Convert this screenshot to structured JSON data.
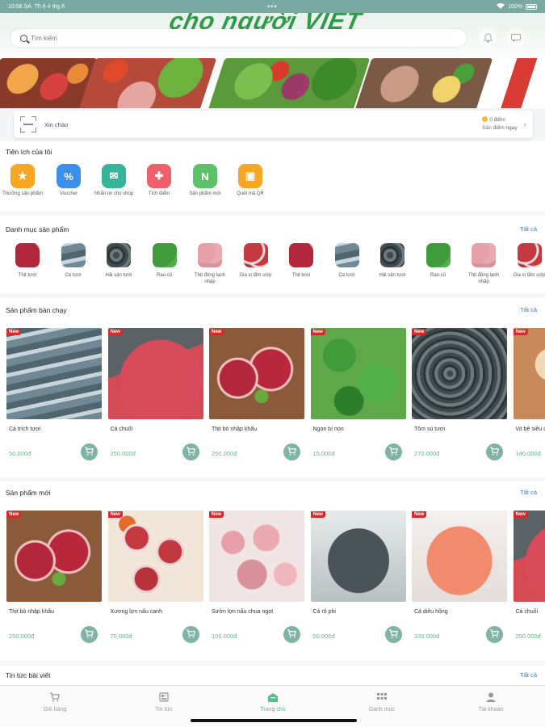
{
  "status_bar": {
    "time": "10:58 SA",
    "date": "Th 6 4 thg 8",
    "dots": "•••",
    "battery": "100%"
  },
  "banner": {
    "slogan": "cho người VIỆT"
  },
  "search": {
    "placeholder": "Tìm kiếm"
  },
  "greeting": {
    "text": "Xin chào",
    "points": "0 điểm",
    "points_link": "Săn điểm ngay"
  },
  "utilities": {
    "title": "Tiện ích của tôi",
    "items": [
      {
        "label": "Thưởng sản phẩm",
        "color": "#f5a623",
        "icon": "gift-icon"
      },
      {
        "label": "Voucher",
        "color": "#3d8fe8",
        "icon": "voucher-icon"
      },
      {
        "label": "Nhắn tin cho shop",
        "color": "#36b39a",
        "icon": "chat-icon"
      },
      {
        "label": "Tích điểm",
        "color": "#f0606a",
        "icon": "points-icon"
      },
      {
        "label": "Sản phẩm mới",
        "color": "#5cc26a",
        "icon": "new-product-icon"
      },
      {
        "label": "Quét mã QR",
        "color": "#f5a623",
        "icon": "qr-scan-icon"
      }
    ]
  },
  "categories": {
    "title": "Danh mục sản phẩm",
    "see_all": "Tất cả",
    "items": [
      {
        "label": "Thịt tươi",
        "style": "beef"
      },
      {
        "label": "Cá tươi",
        "style": "fish"
      },
      {
        "label": "Hải sản tươi",
        "style": "shrimp"
      },
      {
        "label": "Rau củ",
        "style": "greens"
      },
      {
        "label": "Thịt đông lạnh nhập",
        "style": "pork"
      },
      {
        "label": "Gia vị tẩm ướp",
        "style": "ribs"
      },
      {
        "label": "Thịt tươi",
        "style": "beef"
      },
      {
        "label": "Cá tươi",
        "style": "fish"
      },
      {
        "label": "Hải sản tươi",
        "style": "shrimp"
      },
      {
        "label": "Rau củ",
        "style": "greens"
      },
      {
        "label": "Thịt đông lạnh nhập",
        "style": "pork"
      },
      {
        "label": "Gia vị tẩm ướp",
        "style": "ribs"
      }
    ]
  },
  "best_sellers": {
    "title": "Sản phẩm bán chạy",
    "see_all": "Tất cả",
    "badge": "New",
    "items": [
      {
        "name": "Cá trích tươi",
        "price": "50.000đ",
        "style": "fish"
      },
      {
        "name": "Cá chuối",
        "price": "250.000đ",
        "style": "catfish"
      },
      {
        "name": "Thịt bò nhập khẩu",
        "price": "250.000đ",
        "style": "beef"
      },
      {
        "name": "Ngọn bí non",
        "price": "15.000đ",
        "style": "greens"
      },
      {
        "name": "Tôm sú tươi",
        "price": "270.000đ",
        "style": "shrimp"
      },
      {
        "name": "Vịt bê siêu căn",
        "price": "140.000đ",
        "style": "chicken"
      }
    ]
  },
  "new_products": {
    "title": "Sản phẩm mới",
    "see_all": "Tất cả",
    "badge": "New",
    "items": [
      {
        "name": "Thịt bò nhập khẩu",
        "price": "250.000đ",
        "style": "beef"
      },
      {
        "name": "Xương lợn nấu canh",
        "price": "70.000đ",
        "style": "ribs"
      },
      {
        "name": "Sườn lợn nấu chua ngọt",
        "price": "100.000đ",
        "style": "pork"
      },
      {
        "name": "Cá rô phi",
        "price": "50.000đ",
        "style": "tilapia"
      },
      {
        "name": "Cá diêu hồng",
        "price": "100.000đ",
        "style": "redfish"
      },
      {
        "name": "Cá chuối",
        "price": "250.000đ",
        "style": "catfish"
      }
    ]
  },
  "news": {
    "title": "Tin tức bài viết",
    "see_all": "Tất cả"
  },
  "tabbar": {
    "active": "Trang chủ",
    "items": [
      {
        "label": "Giỏ hàng",
        "icon": "cart-icon"
      },
      {
        "label": "Tin tức",
        "icon": "news-icon"
      },
      {
        "label": "Trang chủ",
        "icon": "home-icon"
      },
      {
        "label": "Danh mục",
        "icon": "grid-icon"
      },
      {
        "label": "Tài khoản",
        "icon": "user-icon"
      }
    ]
  }
}
